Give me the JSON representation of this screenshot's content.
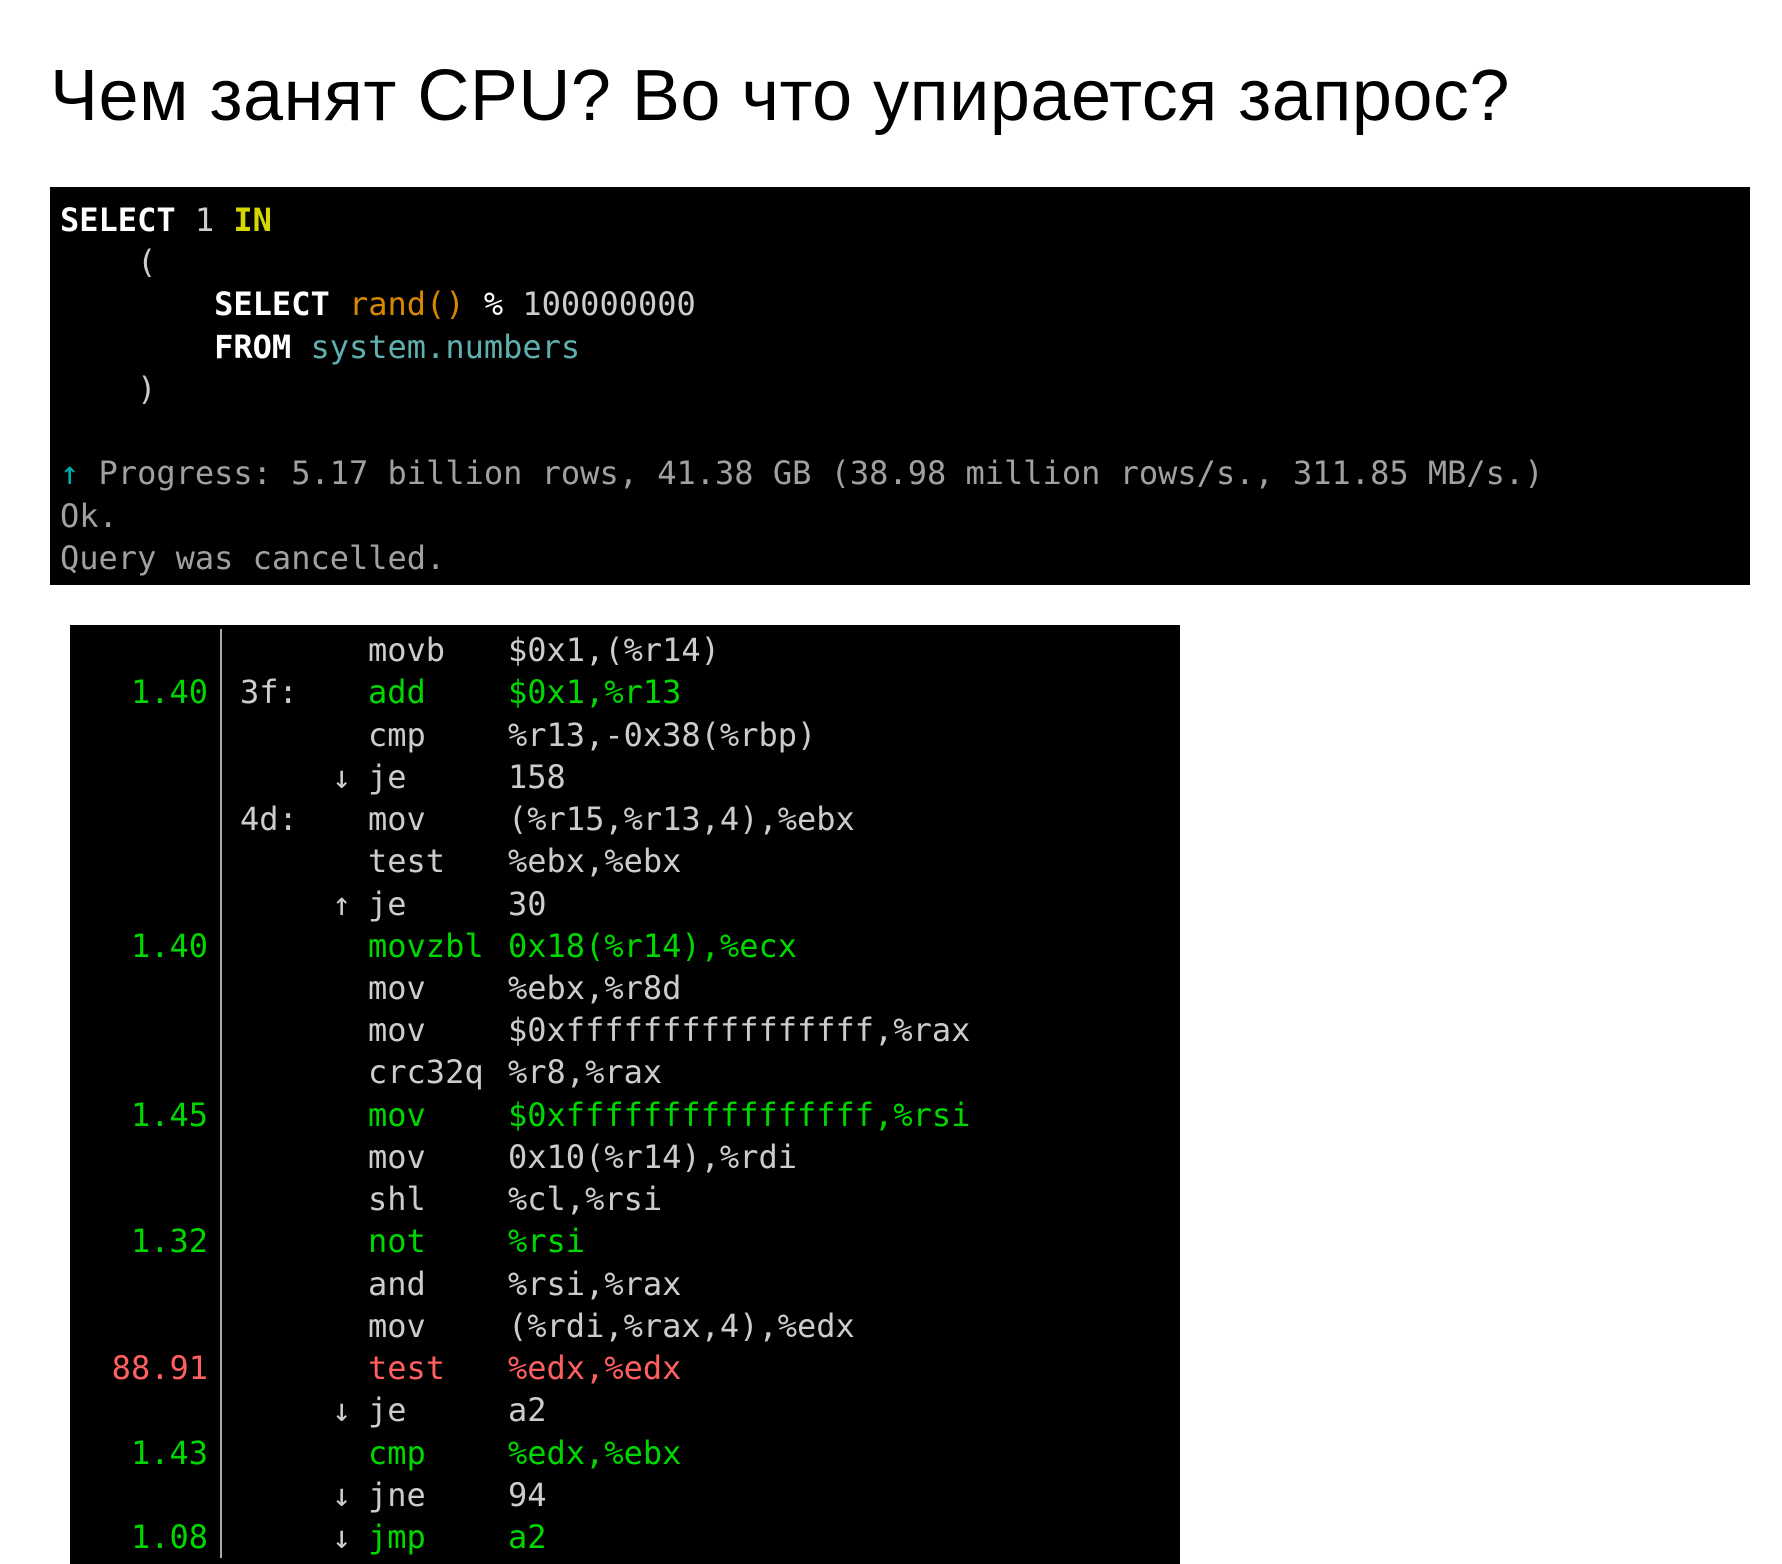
{
  "title": "Чем занят CPU? Во что упирается запрос?",
  "sql": {
    "l1_select": "SELECT",
    "l1_one": " 1 ",
    "l1_in": "IN",
    "l2_paren": "    (",
    "l3_select": "        SELECT",
    "l3_func": " rand()",
    "l3_pct": " %",
    "l3_num": " 100000000",
    "l4_from": "        FROM",
    "l4_tbl": " system.numbers",
    "l5_paren": "    )",
    "blank": "",
    "progress_arrow": "↑",
    "progress": " Progress: 5.17 billion rows, 41.38 GB (38.98 million rows/s., 311.85 MB/s.)",
    "ok": "Ok.",
    "cancelled": "Query was cancelled."
  },
  "asm": [
    {
      "pct": "",
      "pcls": "",
      "lbl": "",
      "arr": "",
      "mn": "movb",
      "mcls": "w",
      "args": "$0x1,(%r14)",
      "acls": "w"
    },
    {
      "pct": "1.40",
      "pcls": "g",
      "lbl": "3f:",
      "arr": "",
      "mn": "add",
      "mcls": "g",
      "args": "$0x1,%r13",
      "acls": "g"
    },
    {
      "pct": "",
      "pcls": "",
      "lbl": "",
      "arr": "",
      "mn": "cmp",
      "mcls": "w",
      "args": "%r13,-0x38(%rbp)",
      "acls": "w"
    },
    {
      "pct": "",
      "pcls": "",
      "lbl": "",
      "arr": "↓",
      "mn": "je",
      "mcls": "w",
      "args": "158",
      "acls": "w"
    },
    {
      "pct": "",
      "pcls": "",
      "lbl": "4d:",
      "arr": "",
      "mn": "mov",
      "mcls": "w",
      "args": "(%r15,%r13,4),%ebx",
      "acls": "w"
    },
    {
      "pct": "",
      "pcls": "",
      "lbl": "",
      "arr": "",
      "mn": "test",
      "mcls": "w",
      "args": "%ebx,%ebx",
      "acls": "w"
    },
    {
      "pct": "",
      "pcls": "",
      "lbl": "",
      "arr": "↑",
      "mn": "je",
      "mcls": "w",
      "args": "30",
      "acls": "w"
    },
    {
      "pct": "1.40",
      "pcls": "g",
      "lbl": "",
      "arr": "",
      "mn": "movzbl",
      "mcls": "g",
      "args": "0x18(%r14),%ecx",
      "acls": "g"
    },
    {
      "pct": "",
      "pcls": "",
      "lbl": "",
      "arr": "",
      "mn": "mov",
      "mcls": "w",
      "args": "%ebx,%r8d",
      "acls": "w"
    },
    {
      "pct": "",
      "pcls": "",
      "lbl": "",
      "arr": "",
      "mn": "mov",
      "mcls": "w",
      "args": "$0xffffffffffffffff,%rax",
      "acls": "w"
    },
    {
      "pct": "",
      "pcls": "",
      "lbl": "",
      "arr": "",
      "mn": "crc32q",
      "mcls": "w",
      "args": "%r8,%rax",
      "acls": "w"
    },
    {
      "pct": "1.45",
      "pcls": "g",
      "lbl": "",
      "arr": "",
      "mn": "mov",
      "mcls": "g",
      "args": "$0xffffffffffffffff,%rsi",
      "acls": "g"
    },
    {
      "pct": "",
      "pcls": "",
      "lbl": "",
      "arr": "",
      "mn": "mov",
      "mcls": "w",
      "args": "0x10(%r14),%rdi",
      "acls": "w"
    },
    {
      "pct": "",
      "pcls": "",
      "lbl": "",
      "arr": "",
      "mn": "shl",
      "mcls": "w",
      "args": "%cl,%rsi",
      "acls": "w"
    },
    {
      "pct": "1.32",
      "pcls": "g",
      "lbl": "",
      "arr": "",
      "mn": "not",
      "mcls": "g",
      "args": "%rsi",
      "acls": "g"
    },
    {
      "pct": "",
      "pcls": "",
      "lbl": "",
      "arr": "",
      "mn": "and",
      "mcls": "w",
      "args": "%rsi,%rax",
      "acls": "w"
    },
    {
      "pct": "",
      "pcls": "",
      "lbl": "",
      "arr": "",
      "mn": "mov",
      "mcls": "w",
      "args": "(%rdi,%rax,4),%edx",
      "acls": "w"
    },
    {
      "pct": "88.91",
      "pcls": "r",
      "lbl": "",
      "arr": "",
      "mn": "test",
      "mcls": "r",
      "args": "%edx,%edx",
      "acls": "r"
    },
    {
      "pct": "",
      "pcls": "",
      "lbl": "",
      "arr": "↓",
      "mn": "je",
      "mcls": "w",
      "args": "a2",
      "acls": "w"
    },
    {
      "pct": "1.43",
      "pcls": "g",
      "lbl": "",
      "arr": "",
      "mn": "cmp",
      "mcls": "g",
      "args": "%edx,%ebx",
      "acls": "g"
    },
    {
      "pct": "",
      "pcls": "",
      "lbl": "",
      "arr": "↓",
      "mn": "jne",
      "mcls": "w",
      "args": "94",
      "acls": "w"
    },
    {
      "pct": "1.08",
      "pcls": "g",
      "lbl": "",
      "arr": "↓",
      "mn": "jmp",
      "mcls": "g",
      "args": "a2",
      "acls": "g"
    }
  ]
}
